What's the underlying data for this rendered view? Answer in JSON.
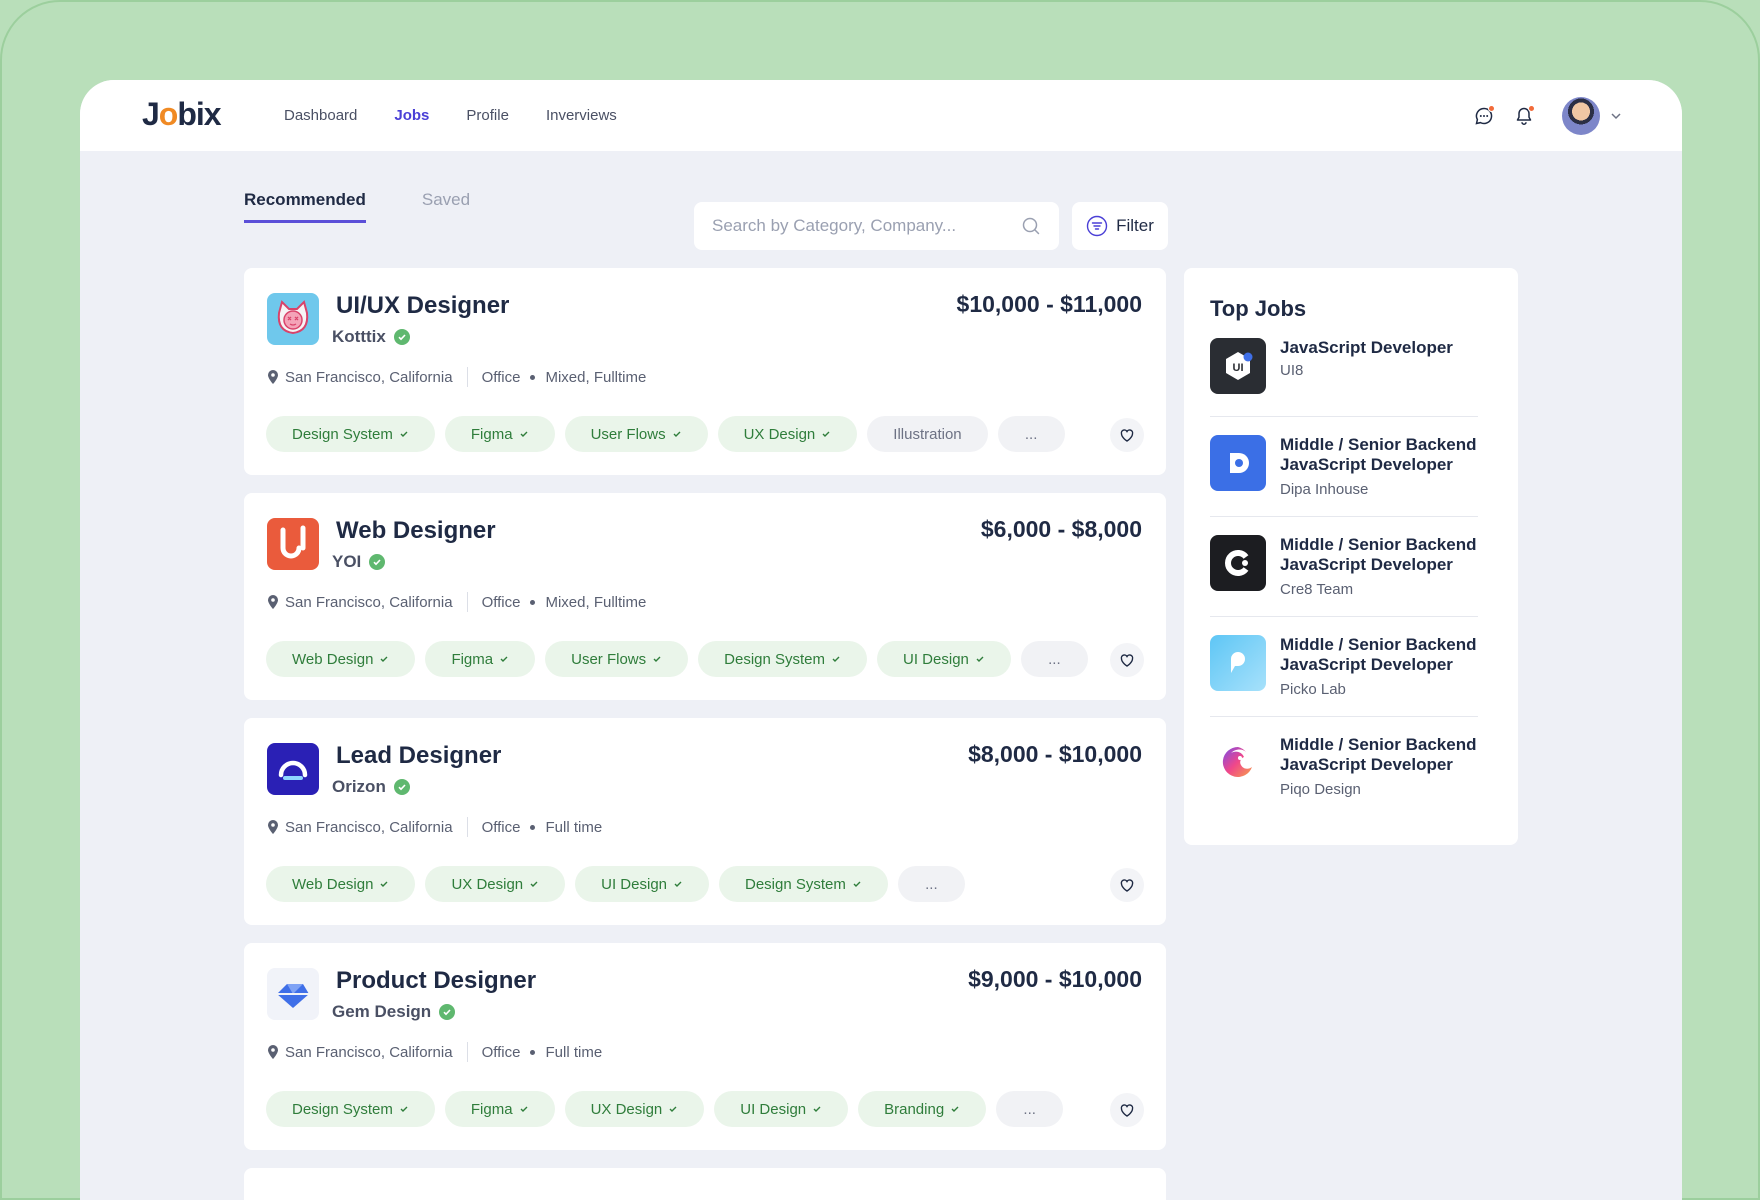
{
  "app": {
    "logo_prefix": "J",
    "logo_o": "o",
    "logo_suffix": "bix"
  },
  "nav": {
    "items": [
      "Dashboard",
      "Jobs",
      "Profile",
      "Inverviews"
    ],
    "active": "Jobs"
  },
  "tabs": {
    "recommended": "Recommended",
    "saved": "Saved"
  },
  "search": {
    "placeholder": "Search by Category, Company...",
    "value": ""
  },
  "filter_label": "Filter",
  "jobs": [
    {
      "title": "UI/UX Designer",
      "company": "Kotttix",
      "salary": "$10,000 - $11,000",
      "location": "San Francisco, California",
      "workplace": "Office",
      "type": "Mixed, Fulltime",
      "tags": [
        "Design System",
        "Figma",
        "User Flows",
        "UX Design"
      ],
      "plain_tags": [
        "Illustration"
      ],
      "more": "...",
      "logo_icon": "cat-face-icon"
    },
    {
      "title": "Web Designer",
      "company": "YOI",
      "salary": "$6,000 - $8,000",
      "location": "San Francisco, California",
      "workplace": "Office",
      "type": "Mixed, Fulltime",
      "tags": [
        "Web Design",
        "Figma",
        "User Flows",
        "Design System",
        "UI Design"
      ],
      "plain_tags": [],
      "more": "...",
      "logo_icon": "yoi-logo-icon"
    },
    {
      "title": "Lead Designer",
      "company": "Orizon",
      "salary": "$8,000 - $10,000",
      "location": "San Francisco, California",
      "workplace": "Office",
      "type": "Full time",
      "tags": [
        "Web Design",
        "UX Design",
        "UI Design",
        "Design System"
      ],
      "plain_tags": [],
      "more": "...",
      "logo_icon": "orizon-logo-icon"
    },
    {
      "title": "Product Designer",
      "company": "Gem Design",
      "salary": "$9,000 - $10,000",
      "location": "San Francisco, California",
      "workplace": "Office",
      "type": "Full time",
      "tags": [
        "Design System",
        "Figma",
        "UX Design",
        "UI Design",
        "Branding"
      ],
      "plain_tags": [],
      "more": "...",
      "logo_icon": "gem-logo-icon"
    }
  ],
  "top_jobs": {
    "title": "Top Jobs",
    "items": [
      {
        "title": "JavaScript Developer",
        "company": "UI8",
        "logo_text": "UI",
        "logo_icon": "ui8-logo-icon"
      },
      {
        "title": "Middle / Senior Backend JavaScript Developer",
        "company": "Dipa Inhouse",
        "logo_icon": "dipa-logo-icon"
      },
      {
        "title": "Middle / Senior Backend JavaScript Developer",
        "company": "Cre8 Team",
        "logo_icon": "cre8-logo-icon"
      },
      {
        "title": "Middle / Senior Backend JavaScript Developer",
        "company": "Picko Lab",
        "logo_icon": "picko-logo-icon"
      },
      {
        "title": "Middle / Senior Backend JavaScript Developer",
        "company": "Piqo Design",
        "logo_icon": "piqo-logo-icon"
      }
    ]
  },
  "colors": {
    "accent": "#4a3fd6",
    "tag_bg": "#eaf5ea",
    "tag_text": "#2f7d3b",
    "verified": "#5fb86f",
    "frame_green": "#b9dfba"
  }
}
